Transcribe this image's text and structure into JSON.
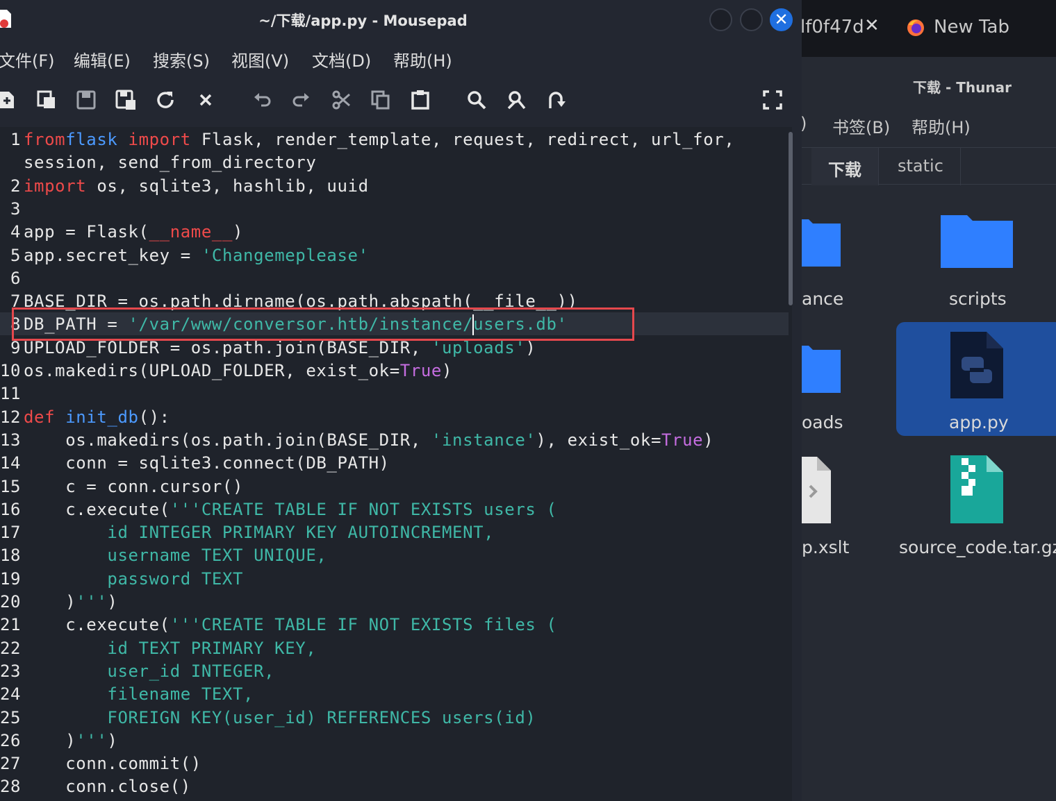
{
  "editor": {
    "title": "~/下载/app.py - Mousepad",
    "close_glyph": "✕",
    "menu": [
      "文件(F)",
      "编辑(E)",
      "搜索(S)",
      "视图(V)",
      "文档(D)",
      "帮助(H)"
    ],
    "toolbar_icons": [
      "new-file-icon",
      "new-window-icon",
      "save-icon",
      "save-as-icon",
      "reload-icon",
      "close-doc-icon",
      "undo-icon",
      "redo-icon",
      "cut-icon",
      "copy-icon",
      "paste-icon",
      "search-icon",
      "replace-icon",
      "goto-icon",
      "fullscreen-icon"
    ],
    "lines": [
      {
        "n": "1",
        "t": [
          [
            "kw",
            "from"
          ],
          [
            "",
            ""
          ],
          [
            " ",
            ""
          ],
          [
            "mod",
            "flask"
          ],
          [
            "",
            " "
          ],
          [
            "kw",
            "import"
          ],
          [
            "",
            " Flask, render_template, request, redirect, url_for,"
          ]
        ]
      },
      {
        "n": "",
        "t": [
          [
            "",
            "session, send_from_directory"
          ]
        ]
      },
      {
        "n": "2",
        "t": [
          [
            "kw",
            "import"
          ],
          [
            "",
            " os, sqlite3, hashlib, uuid"
          ]
        ]
      },
      {
        "n": "3",
        "t": []
      },
      {
        "n": "4",
        "t": [
          [
            "",
            "app = Flask("
          ],
          [
            "dunder",
            "__name__"
          ],
          [
            "",
            ")"
          ]
        ]
      },
      {
        "n": "5",
        "t": [
          [
            "",
            "app.secret_key = "
          ],
          [
            "str",
            "'Changemeplease'"
          ]
        ]
      },
      {
        "n": "6",
        "t": []
      },
      {
        "n": "7",
        "t": [
          [
            "",
            "BASE_DIR = os.path.dirname(os.path.abspath(__file__))"
          ]
        ]
      },
      {
        "n": "8",
        "t": [
          [
            "",
            "DB_PATH = "
          ],
          [
            "str",
            "'/var/www/conversor.htb/instance/users.db'"
          ]
        ]
      },
      {
        "n": "9",
        "t": [
          [
            "",
            "UPLOAD_FOLDER = os.path.join(BASE_DIR, "
          ],
          [
            "str",
            "'uploads'"
          ],
          [
            "",
            ")"
          ]
        ]
      },
      {
        "n": "10",
        "t": [
          [
            "",
            "os.makedirs(UPLOAD_FOLDER, exist_ok="
          ],
          [
            "bool",
            "True"
          ],
          [
            "",
            ")"
          ]
        ]
      },
      {
        "n": "11",
        "t": []
      },
      {
        "n": "12",
        "t": [
          [
            "kw",
            "def"
          ],
          [
            "",
            " "
          ],
          [
            "mod",
            "init_db"
          ],
          [
            "",
            "():"
          ]
        ]
      },
      {
        "n": "13",
        "t": [
          [
            "",
            "    os.makedirs(os.path.join(BASE_DIR, "
          ],
          [
            "str",
            "'instance'"
          ],
          [
            "",
            "), exist_ok="
          ],
          [
            "bool",
            "True"
          ],
          [
            "",
            ")"
          ]
        ]
      },
      {
        "n": "14",
        "t": [
          [
            "",
            "    conn = sqlite3.connect(DB_PATH)"
          ]
        ]
      },
      {
        "n": "15",
        "t": [
          [
            "",
            "    c = conn.cursor()"
          ]
        ]
      },
      {
        "n": "16",
        "t": [
          [
            "",
            "    c.execute("
          ],
          [
            "str",
            "'''CREATE TABLE IF NOT EXISTS users ("
          ]
        ]
      },
      {
        "n": "17",
        "t": [
          [
            "str",
            "        id INTEGER PRIMARY KEY AUTOINCREMENT,"
          ]
        ]
      },
      {
        "n": "18",
        "t": [
          [
            "str",
            "        username TEXT UNIQUE,"
          ]
        ]
      },
      {
        "n": "19",
        "t": [
          [
            "str",
            "        password TEXT"
          ]
        ]
      },
      {
        "n": "20",
        "t": [
          [
            "",
            "    )"
          ],
          [
            "str",
            "'''"
          ],
          [
            "",
            ")"
          ]
        ]
      },
      {
        "n": "21",
        "t": [
          [
            "",
            "    c.execute("
          ],
          [
            "str",
            "'''CREATE TABLE IF NOT EXISTS files ("
          ]
        ]
      },
      {
        "n": "22",
        "t": [
          [
            "str",
            "        id TEXT PRIMARY KEY,"
          ]
        ]
      },
      {
        "n": "23",
        "t": [
          [
            "str",
            "        user_id INTEGER,"
          ]
        ]
      },
      {
        "n": "24",
        "t": [
          [
            "str",
            "        filename TEXT,"
          ]
        ]
      },
      {
        "n": "25",
        "t": [
          [
            "str",
            "        FOREIGN KEY(user_id) REFERENCES users(id)"
          ]
        ]
      },
      {
        "n": "26",
        "t": [
          [
            "",
            "    )"
          ],
          [
            "str",
            "'''"
          ],
          [
            "",
            ")"
          ]
        ]
      },
      {
        "n": "27",
        "t": [
          [
            "",
            "    conn.commit()"
          ]
        ]
      },
      {
        "n": "28",
        "t": [
          [
            "",
            "    conn.close()"
          ]
        ]
      }
    ]
  },
  "browser": {
    "tab1_label": "lf0f47d",
    "tab1_close": "✕",
    "tab2_label": "New Tab"
  },
  "thunar": {
    "title": "下载 - Thunar",
    "menu": [
      ")",
      "书签(B)",
      "帮助(H)"
    ],
    "breadcrumbs": [
      "下载",
      "static"
    ],
    "files": [
      "ance",
      "scripts",
      "oads",
      "app.py",
      "p.xslt",
      "source_code.tar.gz"
    ],
    "selected": "app.py"
  },
  "colors": {
    "keyword": "#ee4a4a",
    "module": "#4c9aff",
    "string": "#3fb8a7",
    "boolean": "#c56de0",
    "highlight_box": "#e5484d",
    "folder": "#2f7fff",
    "selection": "#1f4f9e"
  }
}
